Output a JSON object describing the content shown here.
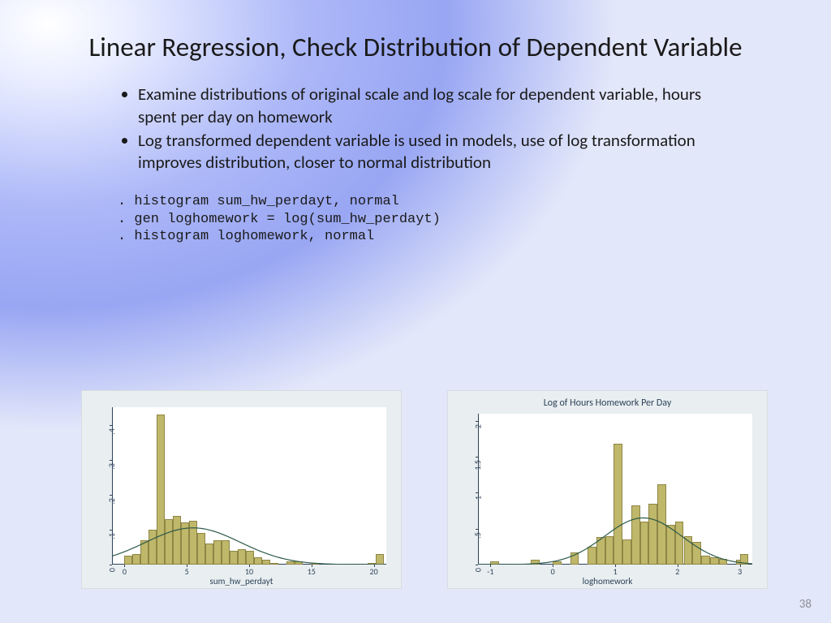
{
  "title": "Linear Regression, Check Distribution of Dependent Variable",
  "bullets": [
    "Examine distributions of original scale and log scale for dependent variable, hours spent per day on homework",
    "Log transformed dependent variable is used in models, use of log transformation improves distribution, closer to normal distribution"
  ],
  "code_lines": [
    ". histogram sum_hw_perdayt, normal",
    ". gen loghomework = log(sum_hw_perdayt)",
    ". histogram loghomework, normal"
  ],
  "page_number": "38",
  "chart_data": [
    {
      "type": "bar",
      "title": "",
      "xlabel": "sum_hw_perdayt",
      "ylabel": "",
      "x_ticks": [
        0,
        5,
        10,
        15,
        20
      ],
      "y_ticks": [
        0,
        0.1,
        0.2,
        0.3,
        0.4
      ],
      "y_tick_labels": [
        "0",
        ".1",
        ".2",
        ".3",
        ".4"
      ],
      "xlim": [
        -1,
        21
      ],
      "ylim": [
        0,
        0.45
      ],
      "bin_width": 0.65,
      "bars": [
        {
          "x": 0,
          "y": 0.025
        },
        {
          "x": 0.65,
          "y": 0.03
        },
        {
          "x": 1.3,
          "y": 0.07
        },
        {
          "x": 1.95,
          "y": 0.1
        },
        {
          "x": 2.6,
          "y": 0.43
        },
        {
          "x": 3.25,
          "y": 0.13
        },
        {
          "x": 3.9,
          "y": 0.14
        },
        {
          "x": 4.55,
          "y": 0.12
        },
        {
          "x": 5.2,
          "y": 0.125
        },
        {
          "x": 5.85,
          "y": 0.09
        },
        {
          "x": 6.5,
          "y": 0.06
        },
        {
          "x": 7.15,
          "y": 0.07
        },
        {
          "x": 7.8,
          "y": 0.07
        },
        {
          "x": 8.45,
          "y": 0.04
        },
        {
          "x": 9.1,
          "y": 0.045
        },
        {
          "x": 9.75,
          "y": 0.04
        },
        {
          "x": 10.4,
          "y": 0.02
        },
        {
          "x": 11.05,
          "y": 0.015
        },
        {
          "x": 11.7,
          "y": 0.005
        },
        {
          "x": 13.0,
          "y": 0.01
        },
        {
          "x": 13.65,
          "y": 0.01
        },
        {
          "x": 14.95,
          "y": 0.005
        },
        {
          "x": 19.5,
          "y": 0.005
        },
        {
          "x": 20.15,
          "y": 0.03
        }
      ],
      "normal_curve": {
        "mean": 5.5,
        "sd": 3.8,
        "peak": 0.105
      }
    },
    {
      "type": "bar",
      "title": "Log of Hours Homework Per Day",
      "xlabel": "loghomework",
      "ylabel": "",
      "x_ticks": [
        -1,
        0,
        1,
        2,
        3
      ],
      "y_ticks": [
        0,
        0.5,
        1,
        1.5,
        2
      ],
      "y_tick_labels": [
        "0",
        ".5",
        "1",
        "1.5",
        "2"
      ],
      "xlim": [
        -1.2,
        3.2
      ],
      "ylim": [
        0,
        2.1
      ],
      "bin_width": 0.14,
      "bars": [
        {
          "x": -1.0,
          "y": 0.05
        },
        {
          "x": -0.35,
          "y": 0.07
        },
        {
          "x": 0.0,
          "y": 0.05
        },
        {
          "x": 0.28,
          "y": 0.17
        },
        {
          "x": 0.56,
          "y": 0.25
        },
        {
          "x": 0.7,
          "y": 0.38
        },
        {
          "x": 0.84,
          "y": 0.4
        },
        {
          "x": 0.98,
          "y": 1.68
        },
        {
          "x": 1.12,
          "y": 0.35
        },
        {
          "x": 1.26,
          "y": 0.82
        },
        {
          "x": 1.4,
          "y": 0.6
        },
        {
          "x": 1.54,
          "y": 0.85
        },
        {
          "x": 1.68,
          "y": 1.12
        },
        {
          "x": 1.82,
          "y": 0.55
        },
        {
          "x": 1.96,
          "y": 0.6
        },
        {
          "x": 2.1,
          "y": 0.4
        },
        {
          "x": 2.24,
          "y": 0.32
        },
        {
          "x": 2.38,
          "y": 0.12
        },
        {
          "x": 2.52,
          "y": 0.1
        },
        {
          "x": 2.66,
          "y": 0.08
        },
        {
          "x": 2.94,
          "y": 0.07
        },
        {
          "x": 3.0,
          "y": 0.15
        }
      ],
      "normal_curve": {
        "mean": 1.45,
        "sd": 0.62,
        "peak": 0.65
      }
    }
  ]
}
